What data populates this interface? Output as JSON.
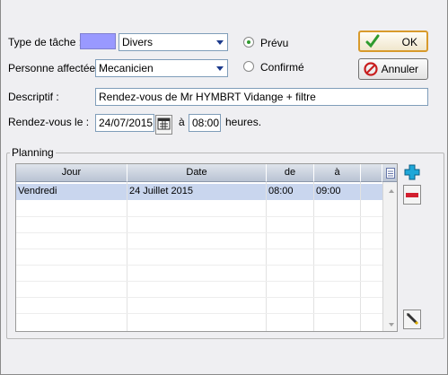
{
  "form": {
    "task_type_label": "Type de tâche :",
    "task_type_value": "Divers",
    "task_color": "#9999ff",
    "assigned_label": "Personne affectée :",
    "assigned_value": "Mecanicien",
    "description_label": "Descriptif :",
    "description_value": "Rendez-vous de Mr HYMBRT Vidange + filtre",
    "appointment_label": "Rendez-vous le :",
    "appointment_date": "24/07/2015",
    "at_label": "à",
    "appointment_time": "08:00",
    "hours_label": "heures."
  },
  "status": {
    "planned_label": "Prévu",
    "planned_selected": true,
    "confirmed_label": "Confirmé",
    "confirmed_selected": false
  },
  "buttons": {
    "ok_label": "OK",
    "cancel_label": "Annuler"
  },
  "planning": {
    "group_label": "Planning",
    "columns": [
      "Jour",
      "Date",
      "de",
      "à"
    ],
    "rows": [
      {
        "day": "Vendredi",
        "date": "24 Juillet 2015",
        "from": "08:00",
        "to": "09:00",
        "selected": true
      }
    ]
  },
  "icons": {
    "ok": "check-icon",
    "cancel": "no-entry-icon",
    "calendar": "calendar-icon",
    "add": "plus-icon",
    "remove": "minus-icon",
    "edit": "pencil-icon",
    "columns": "column-picker-icon"
  },
  "colors": {
    "selected_row": "#c9d6ee",
    "focus_border": "#d89a2c",
    "radio_dot": "#2f9a2f"
  }
}
